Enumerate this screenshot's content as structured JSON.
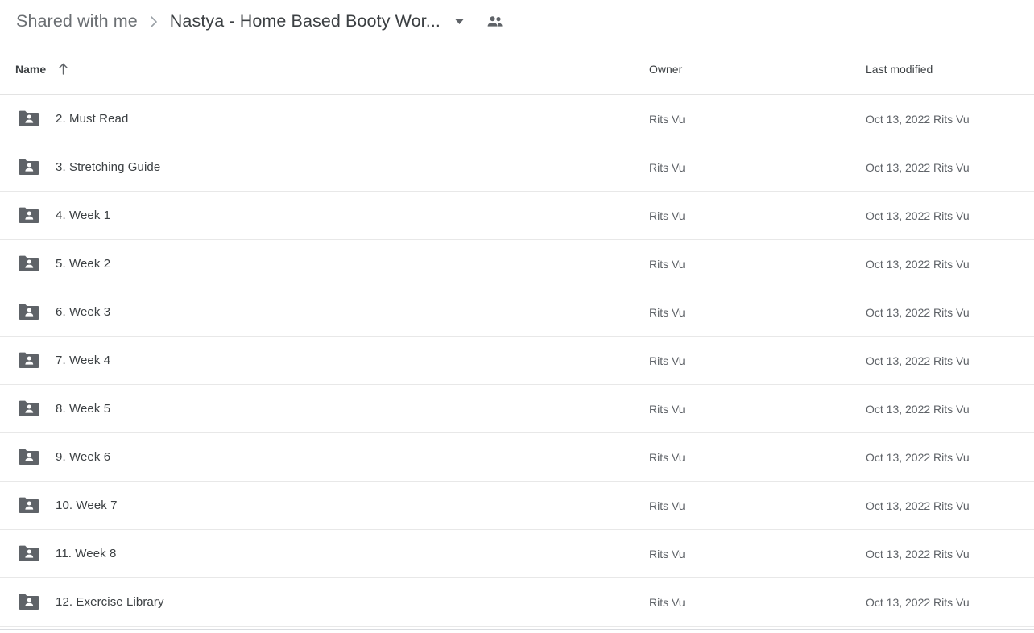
{
  "breadcrumb": {
    "parent_label": "Shared with me",
    "separator_icon": "chevron-right-icon",
    "current_label": "Nastya - Home Based Booty Wor...",
    "dropdown_icon": "caret-down-icon",
    "shared_icon": "people-icon"
  },
  "columns": {
    "name_label": "Name",
    "sort_icon": "arrow-up-icon",
    "owner_label": "Owner",
    "modified_label": "Last modified"
  },
  "colors": {
    "row_text": "#3c4043",
    "secondary_text": "#5f6368",
    "folder_icon": "#5f6368",
    "divider": "#e8e8e8"
  },
  "files": [
    {
      "icon": "shared-folder-icon",
      "name": "2. Must Read",
      "owner": "Rits Vu",
      "modified": "Oct 13, 2022  Rits Vu"
    },
    {
      "icon": "shared-folder-icon",
      "name": "3. Stretching Guide",
      "owner": "Rits Vu",
      "modified": "Oct 13, 2022  Rits Vu"
    },
    {
      "icon": "shared-folder-icon",
      "name": "4. Week 1",
      "owner": "Rits Vu",
      "modified": "Oct 13, 2022  Rits Vu"
    },
    {
      "icon": "shared-folder-icon",
      "name": "5. Week 2",
      "owner": "Rits Vu",
      "modified": "Oct 13, 2022  Rits Vu"
    },
    {
      "icon": "shared-folder-icon",
      "name": "6. Week 3",
      "owner": "Rits Vu",
      "modified": "Oct 13, 2022  Rits Vu"
    },
    {
      "icon": "shared-folder-icon",
      "name": "7. Week 4",
      "owner": "Rits Vu",
      "modified": "Oct 13, 2022  Rits Vu"
    },
    {
      "icon": "shared-folder-icon",
      "name": "8. Week 5",
      "owner": "Rits Vu",
      "modified": "Oct 13, 2022  Rits Vu"
    },
    {
      "icon": "shared-folder-icon",
      "name": "9. Week 6",
      "owner": "Rits Vu",
      "modified": "Oct 13, 2022  Rits Vu"
    },
    {
      "icon": "shared-folder-icon",
      "name": "10. Week 7",
      "owner": "Rits Vu",
      "modified": "Oct 13, 2022  Rits Vu"
    },
    {
      "icon": "shared-folder-icon",
      "name": "11. Week 8",
      "owner": "Rits Vu",
      "modified": "Oct 13, 2022  Rits Vu"
    },
    {
      "icon": "shared-folder-icon",
      "name": "12. Exercise Library",
      "owner": "Rits Vu",
      "modified": "Oct 13, 2022  Rits Vu"
    }
  ]
}
